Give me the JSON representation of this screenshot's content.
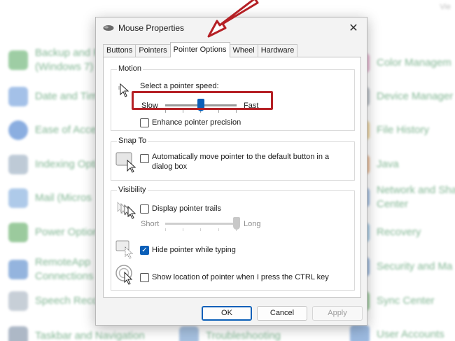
{
  "background": {
    "top_text": "Vie",
    "left_items": [
      "Backup and R",
      "(Windows 7)",
      "Date and Tim",
      "Ease of Acces",
      "Indexing Opti",
      "Mail (Micros",
      "Power Option",
      "RemoteApp",
      "Connections",
      "Speech Reco",
      "Taskbar and Navigation"
    ],
    "right_items": [
      "Color Managem",
      "Device Manager",
      "File History",
      "Java",
      "Network and Sha",
      "Center",
      "Recovery",
      "Security and Ma",
      "Sync Center",
      "User Accounts"
    ],
    "mid_item": "Troubleshooting"
  },
  "dialog": {
    "title": "Mouse Properties",
    "close_glyph": "✕",
    "tabs": [
      "Buttons",
      "Pointers",
      "Pointer Options",
      "Wheel",
      "Hardware"
    ],
    "active_tab": "Pointer Options",
    "motion": {
      "group_label": "Motion",
      "speed_label": "Select a pointer speed:",
      "slow_label": "Slow",
      "fast_label": "Fast",
      "speed_value": 0.5,
      "precision_label": "Enhance pointer precision",
      "precision_checked": false
    },
    "snap_to": {
      "group_label": "Snap To",
      "line1": "Automatically move pointer to the default button in a",
      "line2": "dialog box",
      "checked": false
    },
    "visibility": {
      "group_label": "Visibility",
      "trails_label": "Display pointer trails",
      "trails_checked": false,
      "short_label": "Short",
      "long_label": "Long",
      "trail_value": 1.0,
      "hide_label": "Hide pointer while typing",
      "hide_checked": true,
      "show_location_label": "Show location of pointer when I press the CTRL key",
      "show_location_checked": false
    },
    "buttons": {
      "ok": "OK",
      "cancel": "Cancel",
      "apply": "Apply"
    }
  },
  "colors": {
    "accent": "#0b5fb8",
    "highlight": "#b52025",
    "background_text": "#1a7a3a"
  }
}
